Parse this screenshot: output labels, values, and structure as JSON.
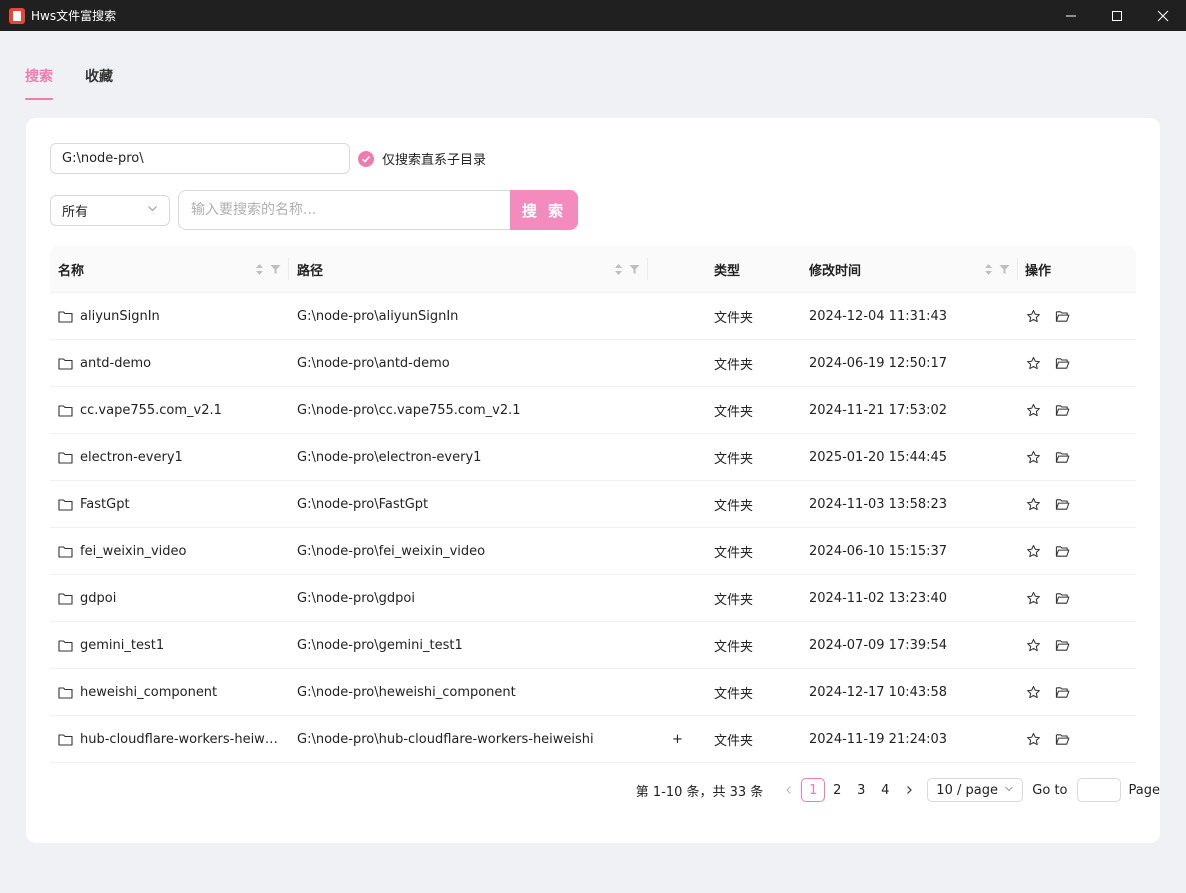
{
  "window": {
    "title": "Hws文件富搜索"
  },
  "tabs": [
    {
      "label": "搜索",
      "active": true
    },
    {
      "label": "收藏",
      "active": false
    }
  ],
  "search": {
    "path_value": "G:\\node-pro\\",
    "checkbox_label": "仅搜索直系子目录",
    "checkbox_checked": true,
    "type_selected": "所有",
    "placeholder": "输入要搜索的名称...",
    "button_label": "搜 索"
  },
  "table": {
    "headers": {
      "name": "名称",
      "path": "路径",
      "type": "类型",
      "time": "修改时间",
      "ops": "操作"
    },
    "rows": [
      {
        "name": "aliyunSignIn",
        "path": "G:\\node-pro\\aliyunSignIn",
        "type": "文件夹",
        "time": "2024-12-04 11:31:43",
        "plus": ""
      },
      {
        "name": "antd-demo",
        "path": "G:\\node-pro\\antd-demo",
        "type": "文件夹",
        "time": "2024-06-19 12:50:17",
        "plus": ""
      },
      {
        "name": "cc.vape755.com_v2.1",
        "path": "G:\\node-pro\\cc.vape755.com_v2.1",
        "type": "文件夹",
        "time": "2024-11-21 17:53:02",
        "plus": ""
      },
      {
        "name": "electron-every1",
        "path": "G:\\node-pro\\electron-every1",
        "type": "文件夹",
        "time": "2025-01-20 15:44:45",
        "plus": ""
      },
      {
        "name": "FastGpt",
        "path": "G:\\node-pro\\FastGpt",
        "type": "文件夹",
        "time": "2024-11-03 13:58:23",
        "plus": ""
      },
      {
        "name": "fei_weixin_video",
        "path": "G:\\node-pro\\fei_weixin_video",
        "type": "文件夹",
        "time": "2024-06-10 15:15:37",
        "plus": ""
      },
      {
        "name": "gdpoi",
        "path": "G:\\node-pro\\gdpoi",
        "type": "文件夹",
        "time": "2024-11-02 13:23:40",
        "plus": ""
      },
      {
        "name": "gemini_test1",
        "path": "G:\\node-pro\\gemini_test1",
        "type": "文件夹",
        "time": "2024-07-09 17:39:54",
        "plus": ""
      },
      {
        "name": "heweishi_component",
        "path": "G:\\node-pro\\heweishi_component",
        "type": "文件夹",
        "time": "2024-12-17 10:43:58",
        "plus": ""
      },
      {
        "name": "hub-cloudflare-workers-heiweishi",
        "path": "G:\\node-pro\\hub-cloudflare-workers-heiweishi",
        "type": "文件夹",
        "time": "2024-11-19 21:24:03",
        "plus": "+"
      }
    ]
  },
  "pagination": {
    "total_text": "第 1-10 条，共 33 条",
    "pages": [
      "1",
      "2",
      "3",
      "4"
    ],
    "current": "1",
    "page_size": "10 / page",
    "goto_label": "Go to",
    "page_label": "Page"
  },
  "colors": {
    "accent": "#f07cae",
    "button": "#f48bbf",
    "titlebar": "#202020"
  }
}
